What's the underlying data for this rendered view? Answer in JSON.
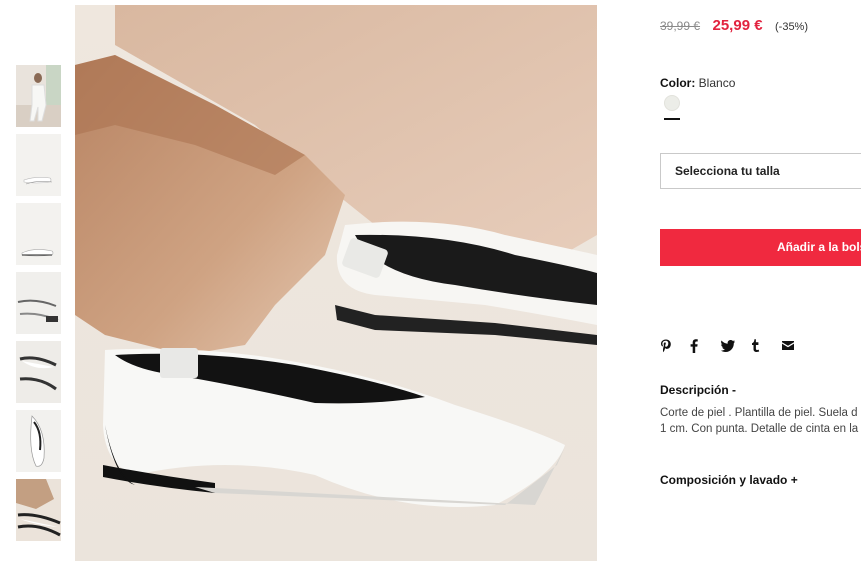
{
  "product": {
    "old_price": "39,99 €",
    "price": "25,99 €",
    "discount": "(-35%)",
    "color_label": "Color:",
    "color_value": "Blanco",
    "size_placeholder": "Selecciona tu talla",
    "add_to_bag": "Añadir a la bols",
    "description_title": "Descripción -",
    "description_line1": "Corte de piel . Plantilla de piel. Suela d",
    "description_line2": "1 cm. Con punta. Detalle de cinta en la",
    "composition_title": "Composición y lavado +"
  },
  "share_icons": [
    "pinterest-icon",
    "facebook-icon",
    "twitter-icon",
    "tumblr-icon",
    "email-icon"
  ],
  "thumbnails": [
    "model-photo",
    "shoe-pair-top",
    "shoe-pair-side",
    "shoe-pair-flat",
    "shoe-pair-angle",
    "shoe-single-top",
    "shoe-with-rock"
  ],
  "colors": {
    "price_red": "#e2233f",
    "button_red": "#f0293f",
    "swatch": "#ecede8"
  }
}
